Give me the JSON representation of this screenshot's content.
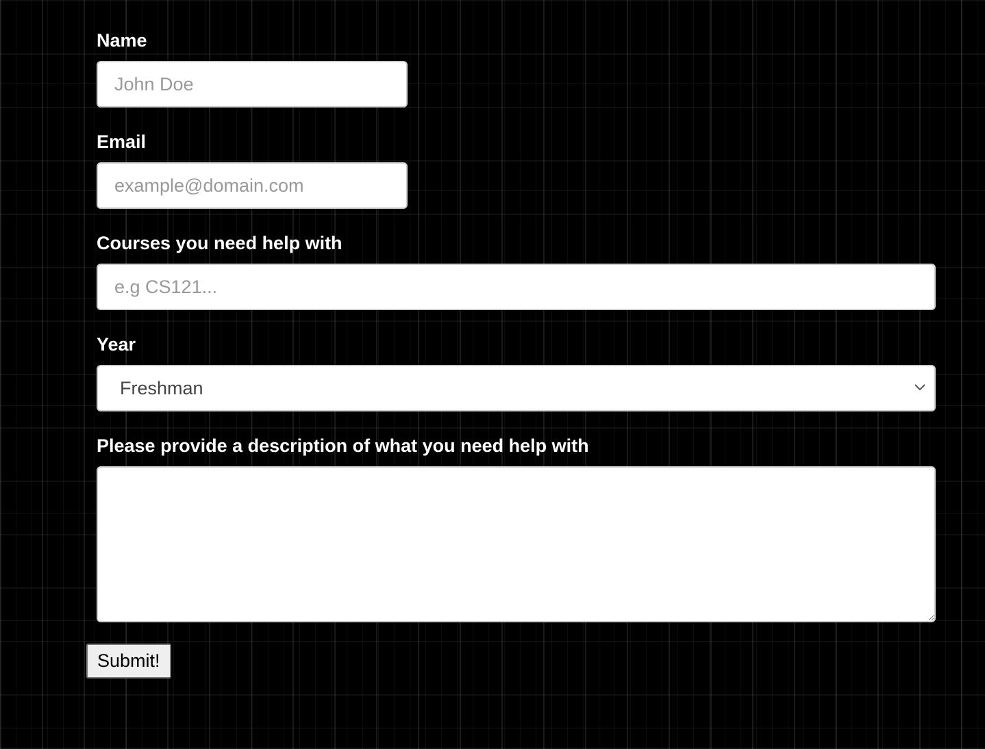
{
  "form": {
    "name": {
      "label": "Name",
      "placeholder": "John Doe",
      "value": ""
    },
    "email": {
      "label": "Email",
      "placeholder": "example@domain.com",
      "value": ""
    },
    "courses": {
      "label": "Courses you need help with",
      "placeholder": "e.g CS121...",
      "value": ""
    },
    "year": {
      "label": "Year",
      "selected": "Freshman"
    },
    "description": {
      "label": "Please provide a description of what you need help with",
      "value": ""
    },
    "submit_label": "Submit!"
  }
}
